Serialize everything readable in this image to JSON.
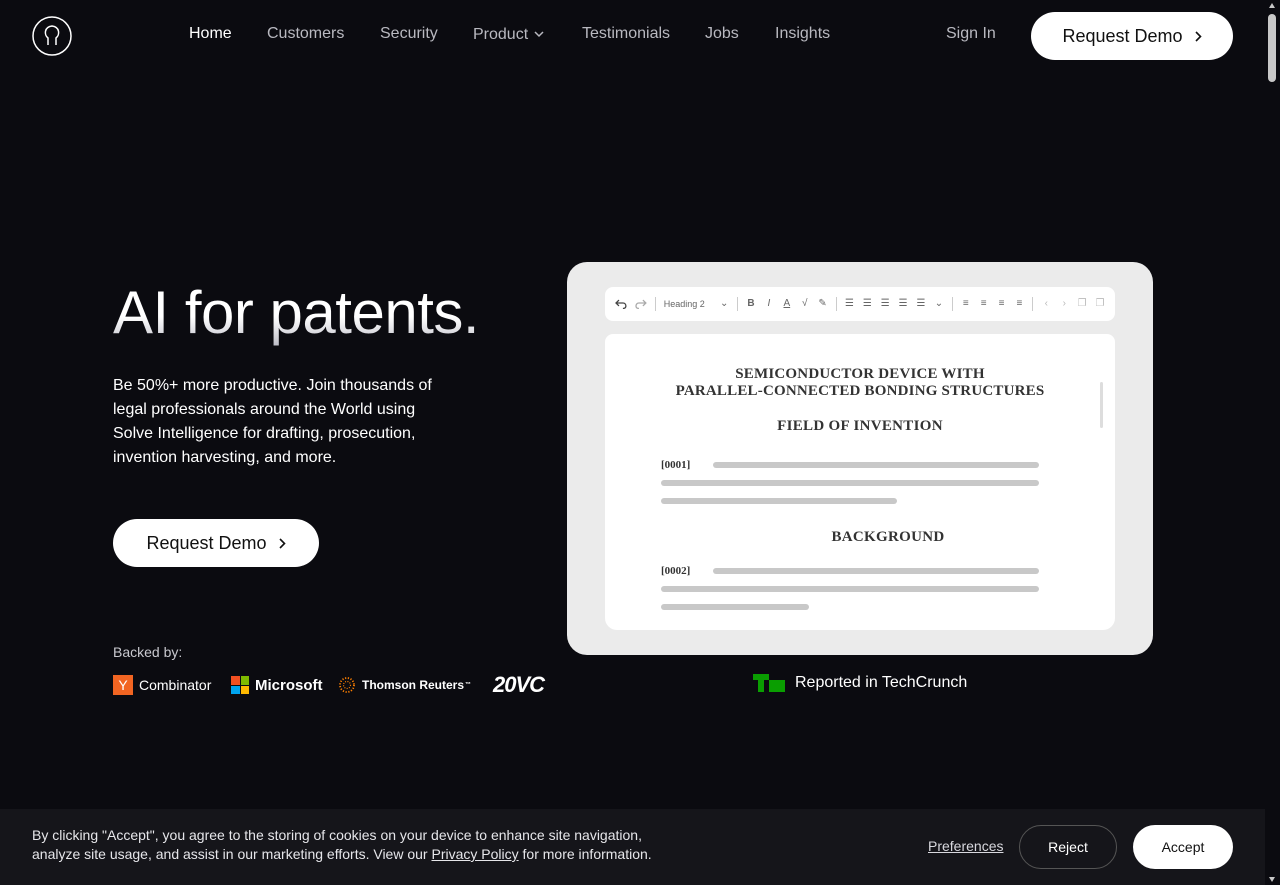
{
  "nav": {
    "items": [
      {
        "label": "Home",
        "active": true
      },
      {
        "label": "Customers"
      },
      {
        "label": "Security"
      },
      {
        "label": "Product",
        "has_dropdown": true
      },
      {
        "label": "Testimonials"
      },
      {
        "label": "Jobs"
      },
      {
        "label": "Insights"
      }
    ],
    "sign_in": "Sign In",
    "request_demo": "Request Demo"
  },
  "hero": {
    "title": "AI for patents.",
    "description": "Be 50%+ more productive. Join thousands of legal professionals around the World using Solve Intelligence for drafting, prosecution, invention harvesting, and more.",
    "cta": "Request Demo",
    "backed_by_label": "Backed by:",
    "backers": [
      "Combinator",
      "Microsoft",
      "Thomson Reuters",
      "20VC"
    ],
    "yc_letter": "Y",
    "tr_suffix": "™"
  },
  "preview": {
    "toolbar_style": "Heading 2",
    "doc_title_line1": "SEMICONDUCTOR DEVICE WITH",
    "doc_title_line2": "PARALLEL-CONNECTED BONDING STRUCTURES",
    "section1": "FIELD OF INVENTION",
    "para1": "[0001]",
    "section2": "BACKGROUND",
    "para2": "[0002]"
  },
  "techcrunch": {
    "text": "Reported in TechCrunch",
    "color": "#0a9e01"
  },
  "cookie": {
    "text_before": "By clicking \"Accept\", you agree to the storing of cookies on your device to enhance site navigation, analyze site usage, and assist in our marketing efforts. View our ",
    "privacy_link": "Privacy Policy",
    "text_after": " for more information.",
    "preferences": "Preferences",
    "reject": "Reject",
    "accept": "Accept"
  }
}
